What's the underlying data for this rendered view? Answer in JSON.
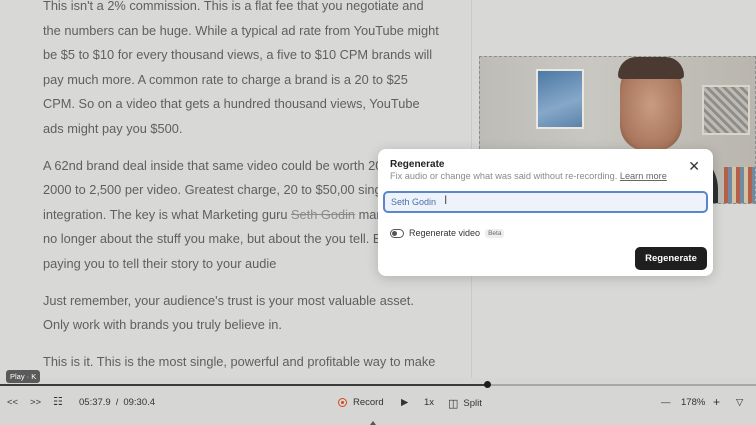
{
  "transcript": {
    "paragraph1": "This isn't a 2% commission. This is a flat fee that you negotiate and the numbers can be huge. While a typical ad rate from YouTube might be $5 to $10 for every thousand views, a five to $10 CPM brands will pay much more. A common rate to charge a brand is a 20 to $25 CPM. So on a video that gets a hundred thousand views, YouTube ads might pay you $500.",
    "paragraph2_before": "A 62nd brand deal inside that same video could be worth 200 2002, 2000 to 2,500 per video. Greatest charge, 20 to $50,00 single integration. The key is what Marketing guru ",
    "paragraph2_strike": "Seth Godin",
    "paragraph2_after": " marketing is no longer about the stuff you make, but about the you tell. Brands are paying you to tell their story to your audie",
    "paragraph3": "Just remember, your audience's trust is your most valuable asset. Only work with brands you truly believe in.",
    "paragraph4": "This is it. This is the most single, powerful and profitable way to make"
  },
  "dialog": {
    "title": "Regenerate",
    "description": "Fix audio or change what was said without re-recording.",
    "learn_more": "Learn more",
    "input_value": "Seth Godin",
    "toggle_label": "Regenerate video",
    "beta_label": "Beta",
    "button_label": "Regenerate",
    "close_glyph": "✕"
  },
  "tooltip": {
    "label": "Play · K"
  },
  "timeline": {
    "progress": 0.644
  },
  "toolbar": {
    "rewind_glyph": "<<",
    "forward_glyph": ">>",
    "chapters_glyph": "☷",
    "current_time": "05:37.9",
    "separator": "/",
    "total_time": "09:30.4",
    "record_label": "Record",
    "play_glyph": "▶",
    "speed_label": "1x",
    "split_glyph": "◫",
    "split_label": "Split",
    "zoom_out_glyph": "—",
    "zoom_level": "178%",
    "zoom_in_glyph": "+",
    "filter_glyph": "▽"
  },
  "colors": {
    "accent_blue": "#5b86c9",
    "record_orange": "#d04a1e",
    "button_dark": "#1f1f1f"
  }
}
